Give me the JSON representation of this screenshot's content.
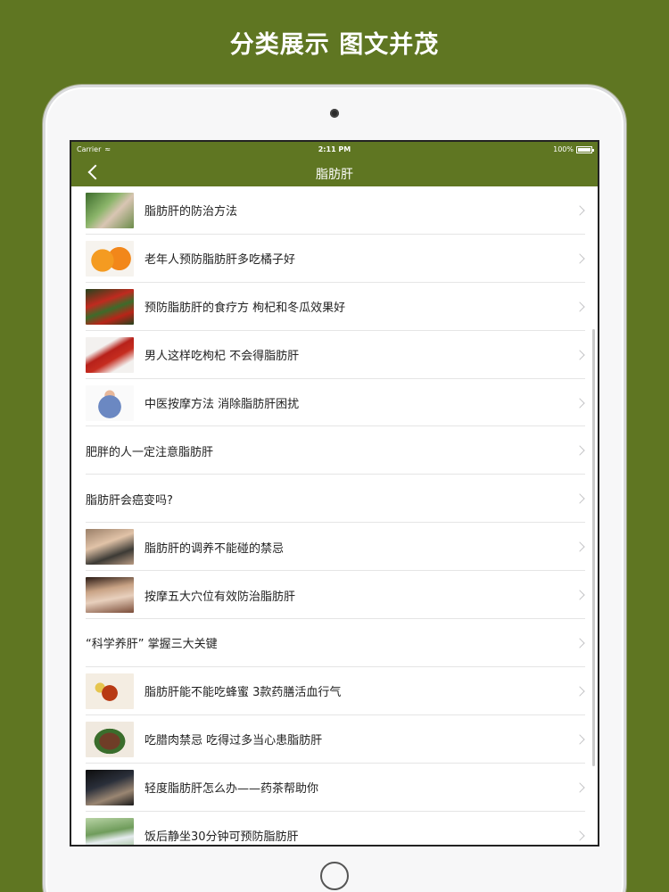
{
  "headline": "分类展示 图文并茂",
  "status_bar": {
    "carrier": "Carrier",
    "time": "2:11 PM",
    "battery": "100%"
  },
  "nav": {
    "title": "脂肪肝"
  },
  "list": [
    {
      "label": "脂肪肝的防治方法",
      "has_image": true
    },
    {
      "label": "老年人预防脂肪肝多吃橘子好",
      "has_image": true
    },
    {
      "label": "预防脂肪肝的食疗方 枸杞和冬瓜效果好",
      "has_image": true
    },
    {
      "label": "男人这样吃枸杞 不会得脂肪肝",
      "has_image": true
    },
    {
      "label": "中医按摩方法 消除脂肪肝困扰",
      "has_image": true
    },
    {
      "label": "肥胖的人一定注意脂肪肝",
      "has_image": false
    },
    {
      "label": "脂肪肝会癌变吗?",
      "has_image": false
    },
    {
      "label": "脂肪肝的调养不能碰的禁忌",
      "has_image": true
    },
    {
      "label": "按摩五大穴位有效防治脂肪肝",
      "has_image": true
    },
    {
      "label": "“科学养肝” 掌握三大关键",
      "has_image": false
    },
    {
      "label": "脂肪肝能不能吃蜂蜜 3款药膳活血行气",
      "has_image": true
    },
    {
      "label": "吃腊肉禁忌 吃得过多当心患脂肪肝",
      "has_image": true
    },
    {
      "label": "轻度脂肪肝怎么办——药茶帮助你",
      "has_image": true
    },
    {
      "label": "饭后静坐30分钟可预防脂肪肝",
      "has_image": true
    }
  ],
  "colors": {
    "background": "#5f7622",
    "nav_bar": "#5f7622"
  }
}
